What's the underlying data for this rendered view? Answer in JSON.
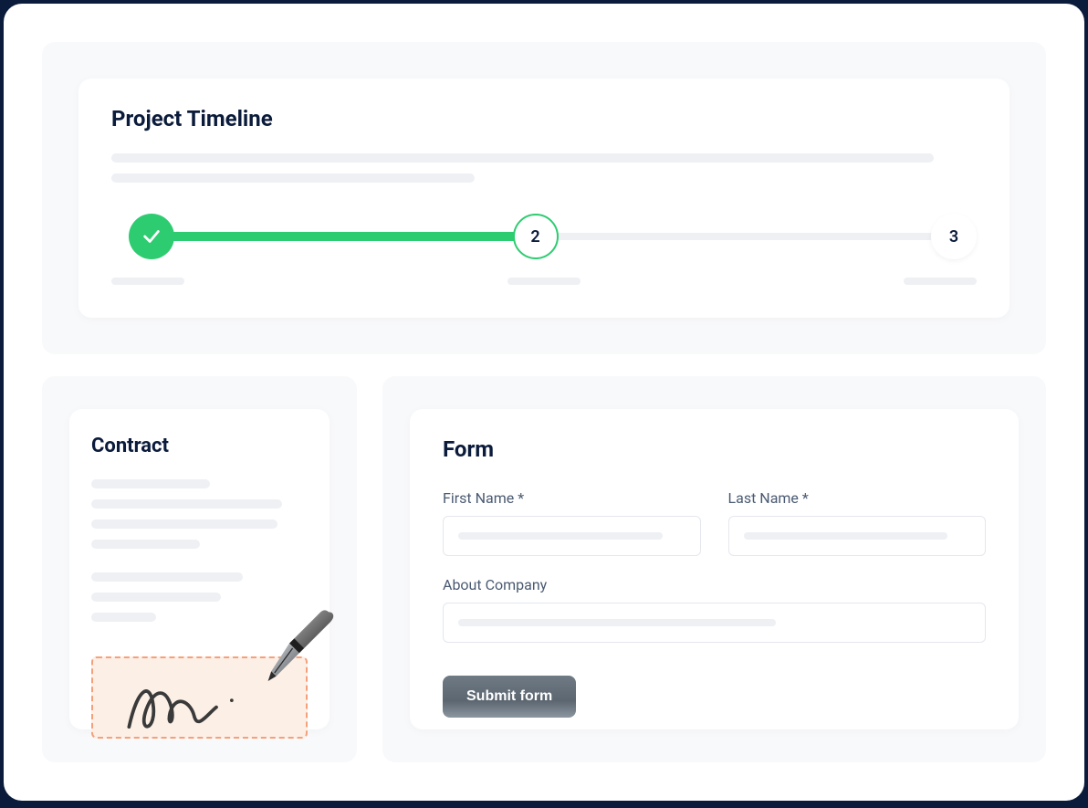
{
  "timeline": {
    "title": "Project Timeline",
    "steps": {
      "step2_label": "2",
      "step3_label": "3"
    }
  },
  "contract": {
    "title": "Contract"
  },
  "form": {
    "title": "Form",
    "first_name_label": "First Name *",
    "last_name_label": "Last Name *",
    "about_label": "About Company",
    "submit_label": "Submit form"
  },
  "colors": {
    "accent_green": "#2ecc71",
    "signature_box_border": "#f5a07a",
    "signature_box_bg": "#fcefe6"
  }
}
